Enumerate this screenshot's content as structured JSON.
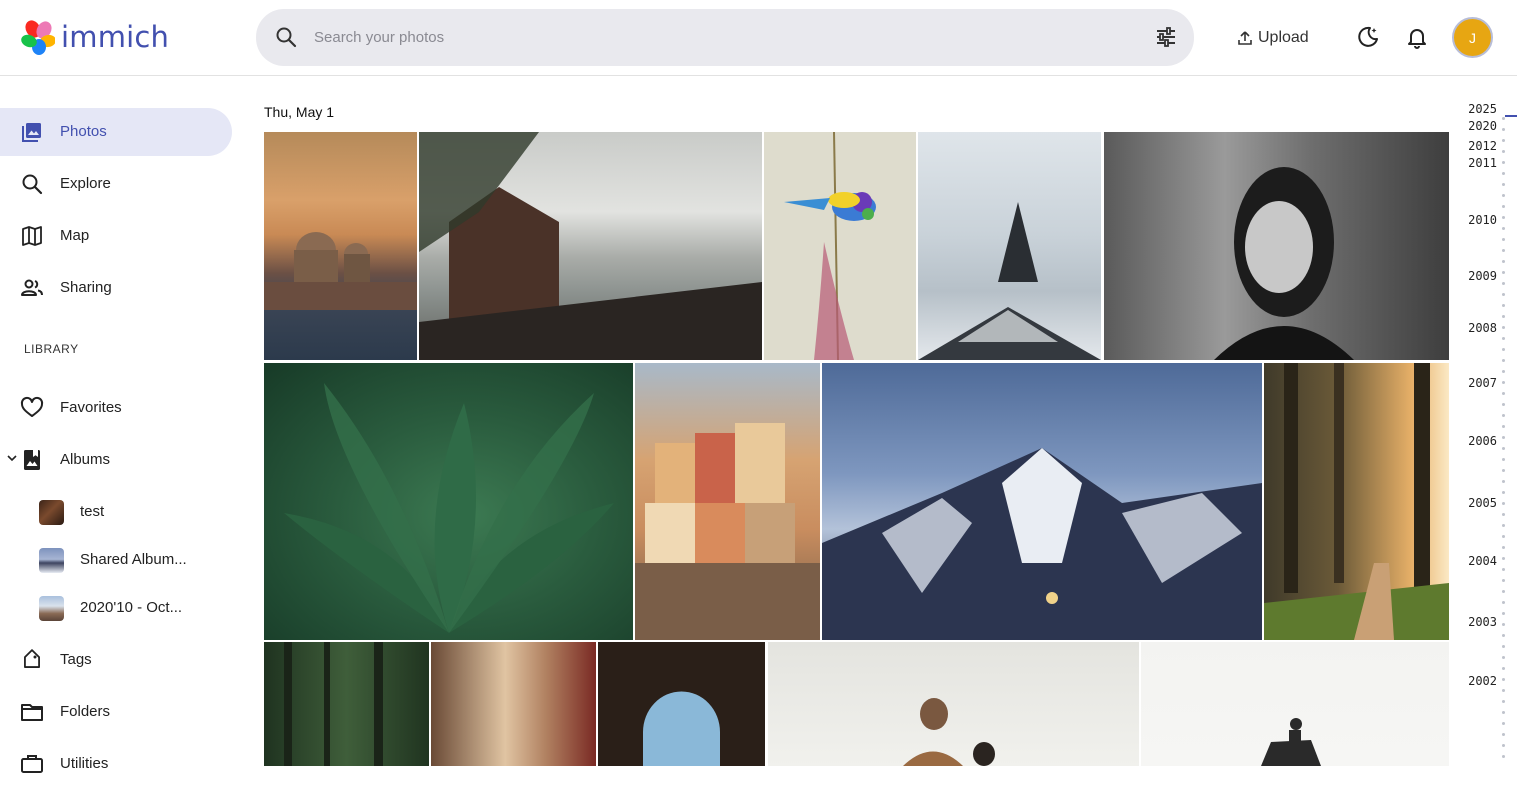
{
  "app": {
    "name": "immich"
  },
  "search": {
    "placeholder": "Search your photos"
  },
  "header": {
    "upload_label": "Upload",
    "avatar_initial": "J"
  },
  "sidebar": {
    "items": [
      {
        "label": "Photos",
        "icon": "photos-icon"
      },
      {
        "label": "Explore",
        "icon": "search-icon"
      },
      {
        "label": "Map",
        "icon": "map-icon"
      },
      {
        "label": "Sharing",
        "icon": "people-icon"
      }
    ],
    "library_title": "LIBRARY",
    "library": [
      {
        "label": "Favorites",
        "icon": "heart-icon"
      },
      {
        "label": "Albums",
        "icon": "album-icon"
      }
    ],
    "albums": [
      {
        "label": "test"
      },
      {
        "label": "Shared Album..."
      },
      {
        "label": "2020'10 - Oct..."
      }
    ],
    "more": [
      {
        "label": "Tags",
        "icon": "tag-icon"
      },
      {
        "label": "Folders",
        "icon": "folder-icon"
      },
      {
        "label": "Utilities",
        "icon": "toolbox-icon"
      }
    ]
  },
  "timeline": {
    "date_group": "Thu, May 1",
    "photos": [
      {
        "name": "venice-sunset"
      },
      {
        "name": "lake-boathouse-fog"
      },
      {
        "name": "colorful-bird"
      },
      {
        "name": "misty-mountain-peak"
      },
      {
        "name": "woman-portrait-bw"
      },
      {
        "name": "agave-plant"
      },
      {
        "name": "cinque-terre-houses"
      },
      {
        "name": "snowy-mountain-star-trails"
      },
      {
        "name": "forest-sunlight-path"
      },
      {
        "name": "dark-forest"
      },
      {
        "name": "narrow-street"
      },
      {
        "name": "stone-arch"
      },
      {
        "name": "couple-outdoors"
      },
      {
        "name": "horse-rider"
      }
    ]
  },
  "scrubber": {
    "years": [
      "2025",
      "2020",
      "2012",
      "2011",
      "2010",
      "2009",
      "2008",
      "2007",
      "2006",
      "2005",
      "2004",
      "2003",
      "2002"
    ]
  },
  "colors": {
    "accent": "#4250af",
    "active_bg": "#e5e7f6",
    "avatar": "#e7a612"
  }
}
